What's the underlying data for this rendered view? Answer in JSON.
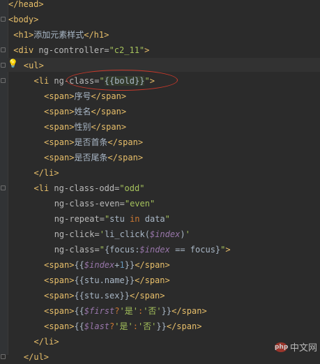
{
  "editor": {
    "lines": [
      {
        "indent": 0,
        "parts": [
          [
            "t",
            "</head>"
          ]
        ]
      },
      {
        "indent": 0,
        "parts": [
          [
            "t",
            "<body>"
          ]
        ]
      },
      {
        "indent": 1,
        "parts": [
          [
            "t",
            "<h1>"
          ],
          [
            "x",
            "添加元素样式"
          ],
          [
            "t",
            "</h1>"
          ]
        ]
      },
      {
        "indent": 1,
        "parts": [
          [
            "t",
            "<div "
          ],
          [
            "a",
            "ng-controller="
          ],
          [
            "v",
            "\"c2_11\""
          ],
          [
            "t",
            ">"
          ]
        ]
      },
      {
        "indent": 3,
        "parts": [
          [
            "t",
            "<ul>"
          ]
        ]
      },
      {
        "indent": 5,
        "parts": [
          [
            "t",
            "<li "
          ],
          [
            "a",
            "ng-class="
          ],
          [
            "v",
            "\""
          ],
          [
            "bind",
            "{{bold}}"
          ],
          [
            "v",
            "\""
          ],
          [
            "t",
            ">"
          ]
        ]
      },
      {
        "indent": 7,
        "parts": [
          [
            "t",
            "<span>"
          ],
          [
            "x",
            "序号"
          ],
          [
            "t",
            "</span>"
          ]
        ]
      },
      {
        "indent": 7,
        "parts": [
          [
            "t",
            "<span>"
          ],
          [
            "x",
            "姓名"
          ],
          [
            "t",
            "</span>"
          ]
        ]
      },
      {
        "indent": 7,
        "parts": [
          [
            "t",
            "<span>"
          ],
          [
            "x",
            "性别"
          ],
          [
            "t",
            "</span>"
          ]
        ]
      },
      {
        "indent": 7,
        "parts": [
          [
            "t",
            "<span>"
          ],
          [
            "x",
            "是否首条"
          ],
          [
            "t",
            "</span>"
          ]
        ]
      },
      {
        "indent": 7,
        "parts": [
          [
            "t",
            "<span>"
          ],
          [
            "x",
            "是否尾条"
          ],
          [
            "t",
            "</span>"
          ]
        ]
      },
      {
        "indent": 5,
        "parts": [
          [
            "t",
            "</li>"
          ]
        ]
      },
      {
        "indent": 5,
        "parts": [
          [
            "t",
            "<li "
          ],
          [
            "a",
            "ng-class-odd="
          ],
          [
            "v",
            "\"odd\""
          ]
        ]
      },
      {
        "indent": 9,
        "parts": [
          [
            "a",
            "ng-class-even="
          ],
          [
            "v",
            "\"even\""
          ]
        ]
      },
      {
        "indent": 9,
        "parts": [
          [
            "a",
            "ng-repeat="
          ],
          [
            "v",
            "\""
          ],
          [
            "x",
            "stu "
          ],
          [
            "kw",
            "in"
          ],
          [
            "x",
            " data"
          ],
          [
            "v",
            "\""
          ]
        ]
      },
      {
        "indent": 9,
        "parts": [
          [
            "a",
            "ng-click="
          ],
          [
            "v",
            "'"
          ],
          [
            "x",
            "li_click("
          ],
          [
            "var",
            "$index"
          ],
          [
            "x",
            ")"
          ],
          [
            "v",
            "'"
          ]
        ]
      },
      {
        "indent": 9,
        "parts": [
          [
            "a",
            "ng-class="
          ],
          [
            "v",
            "\""
          ],
          [
            "x",
            "{focus:"
          ],
          [
            "var",
            "$index"
          ],
          [
            "x",
            " == focus}"
          ],
          [
            "v",
            "\""
          ],
          [
            "t",
            ">"
          ]
        ]
      },
      {
        "indent": 7,
        "parts": [
          [
            "t",
            "<span>"
          ],
          [
            "x",
            "{{"
          ],
          [
            "var",
            "$index"
          ],
          [
            "x",
            "+"
          ],
          [
            "num",
            "1"
          ],
          [
            "x",
            "}}"
          ],
          [
            "t",
            "</span>"
          ]
        ]
      },
      {
        "indent": 7,
        "parts": [
          [
            "t",
            "<span>"
          ],
          [
            "x",
            "{{stu.name}}"
          ],
          [
            "t",
            "</span>"
          ]
        ]
      },
      {
        "indent": 7,
        "parts": [
          [
            "t",
            "<span>"
          ],
          [
            "x",
            "{{stu.sex}}"
          ],
          [
            "t",
            "</span>"
          ]
        ]
      },
      {
        "indent": 7,
        "parts": [
          [
            "t",
            "<span>"
          ],
          [
            "x",
            "{{"
          ],
          [
            "var",
            "$first"
          ],
          [
            "kw",
            "?"
          ],
          [
            "v",
            "'是'"
          ],
          [
            "kw",
            ":"
          ],
          [
            "v",
            "'否'"
          ],
          [
            "x",
            "}}"
          ],
          [
            "t",
            "</span>"
          ]
        ]
      },
      {
        "indent": 7,
        "parts": [
          [
            "t",
            "<span>"
          ],
          [
            "x",
            "{{"
          ],
          [
            "var",
            "$last"
          ],
          [
            "kw",
            "?"
          ],
          [
            "v",
            "'是'"
          ],
          [
            "kw",
            ":"
          ],
          [
            "v",
            "'否'"
          ],
          [
            "x",
            "}}"
          ],
          [
            "t",
            "</span>"
          ]
        ]
      },
      {
        "indent": 5,
        "parts": [
          [
            "t",
            "</li>"
          ]
        ]
      },
      {
        "indent": 3,
        "parts": [
          [
            "t",
            "</ul>"
          ]
        ]
      }
    ]
  },
  "watermark": {
    "logo": "php",
    "text": "中文网"
  }
}
